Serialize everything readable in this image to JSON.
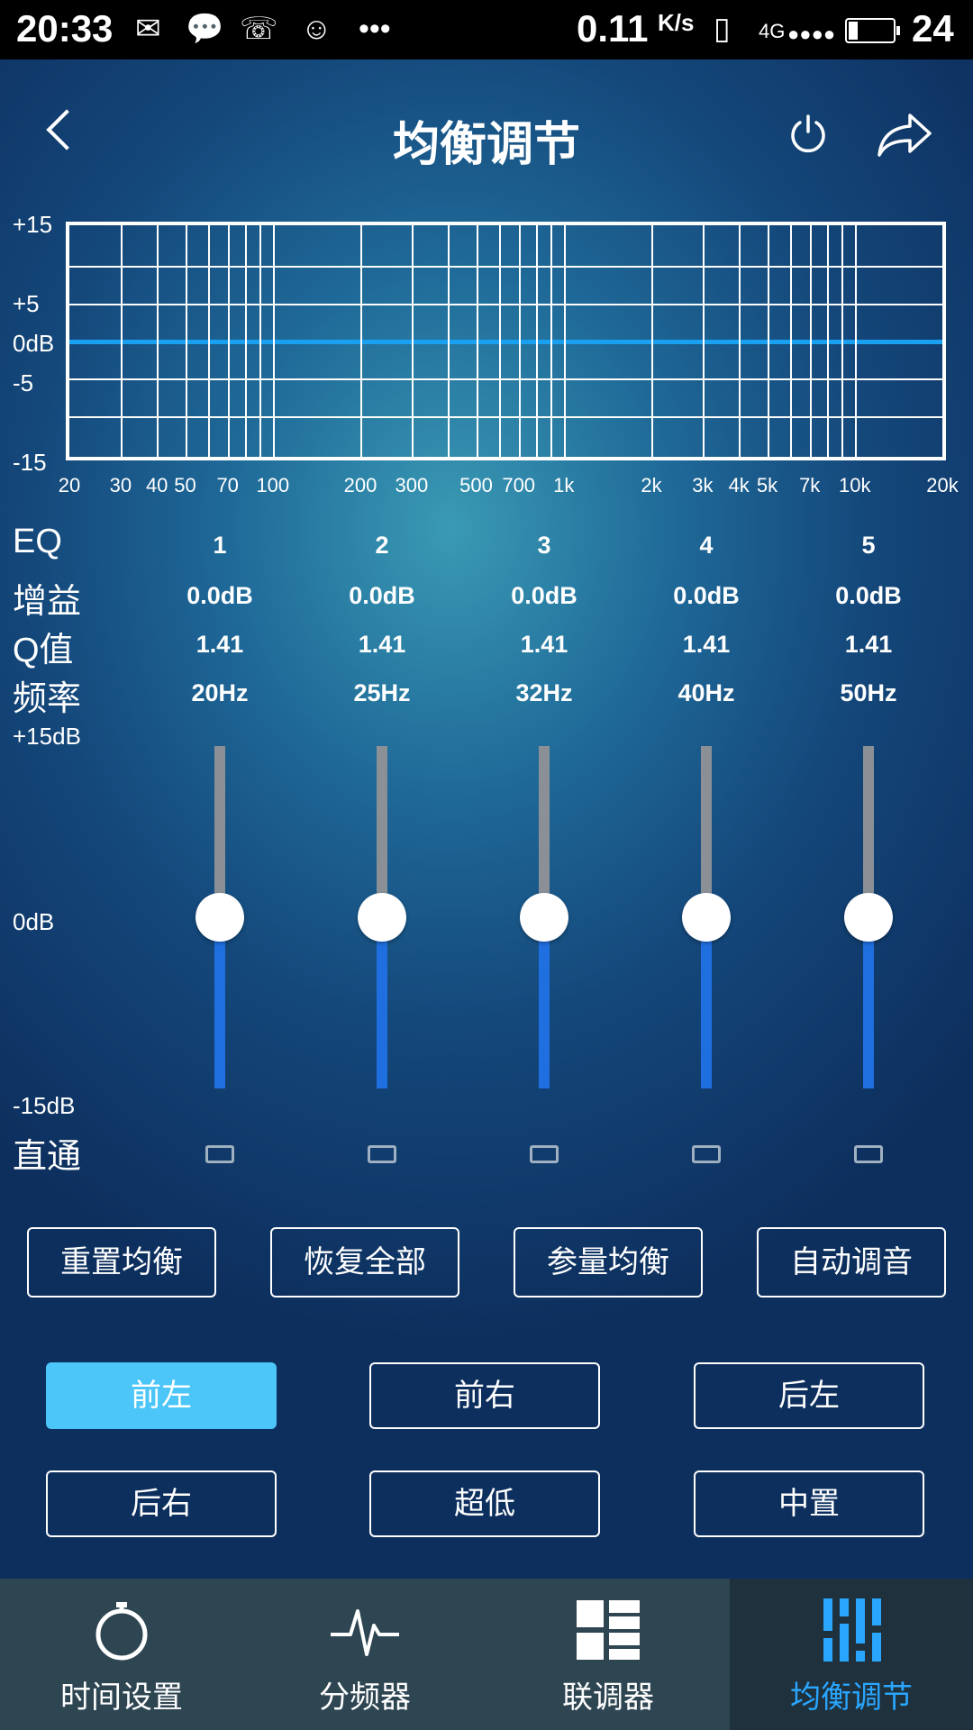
{
  "status_bar": {
    "time": "20:33",
    "speed": "0.11",
    "speed_unit": "K/s",
    "network": "4G",
    "battery": "24"
  },
  "header": {
    "title": "均衡调节"
  },
  "graph": {
    "y_labels": [
      "+15",
      "+5",
      "0dB",
      "-5",
      "-15"
    ],
    "x_labels": [
      "20",
      "30",
      "40",
      "50",
      "70",
      "100",
      "200",
      "300",
      "500",
      "700",
      "1k",
      "2k",
      "3k",
      "4k",
      "5k",
      "7k",
      "10k",
      "20k"
    ],
    "curve_color": "#1aa0f0",
    "curve_db": 0
  },
  "eq_table": {
    "labels": {
      "eq": "EQ",
      "gain": "增益",
      "q": "Q值",
      "freq": "频率",
      "bypass": "直通"
    },
    "bands": [
      {
        "num": "1",
        "gain": "0.0dB",
        "q": "1.41",
        "freq": "20Hz",
        "gain_value": 0
      },
      {
        "num": "2",
        "gain": "0.0dB",
        "q": "1.41",
        "freq": "25Hz",
        "gain_value": 0
      },
      {
        "num": "3",
        "gain": "0.0dB",
        "q": "1.41",
        "freq": "32Hz",
        "gain_value": 0
      },
      {
        "num": "4",
        "gain": "0.0dB",
        "q": "1.41",
        "freq": "40Hz",
        "gain_value": 0
      },
      {
        "num": "5",
        "gain": "0.0dB",
        "q": "1.41",
        "freq": "50Hz",
        "gain_value": 0
      }
    ],
    "scale": {
      "top": "+15dB",
      "mid": "0dB",
      "bottom": "-15dB"
    }
  },
  "actions": [
    "重置均衡",
    "恢复全部",
    "参量均衡",
    "自动调音"
  ],
  "channels": {
    "row1": [
      "前左",
      "前右",
      "后左"
    ],
    "row2": [
      "后右",
      "超低",
      "中置"
    ],
    "selected": "前左",
    "selected_color": "#4cc6f8"
  },
  "bottom_nav": {
    "items": [
      "时间设置",
      "分频器",
      "联调器",
      "均衡调节"
    ],
    "active": "均衡调节",
    "active_color": "#2aa6ff"
  }
}
